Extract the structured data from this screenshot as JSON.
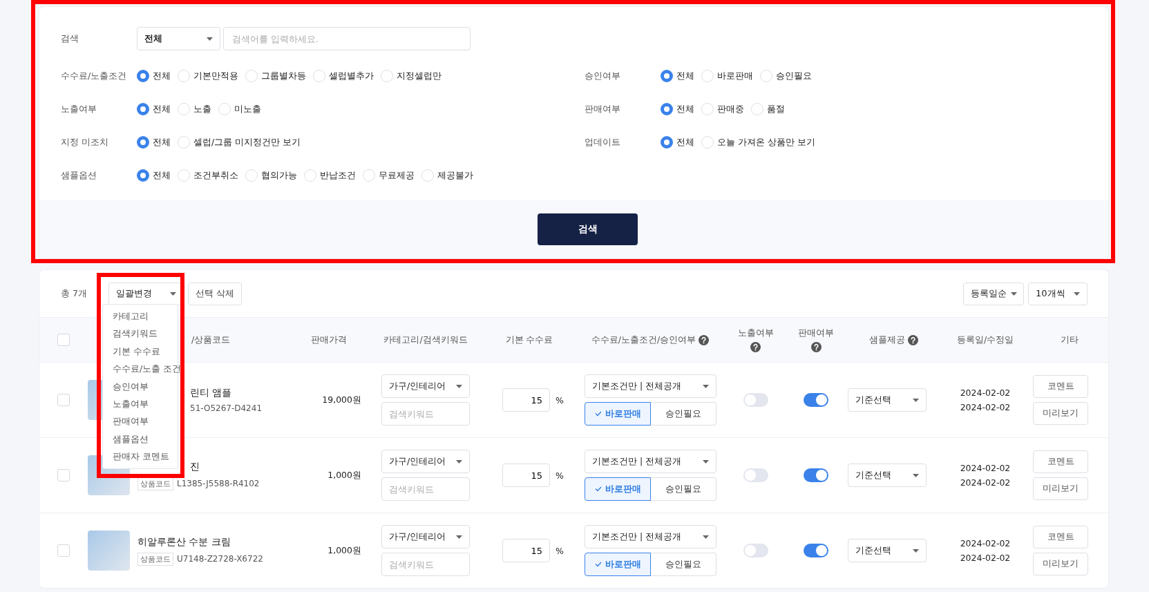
{
  "search_panel": {
    "label": "검색",
    "scope_select": "전체",
    "placeholder": "검색어를 입력하세요.",
    "left_filters": [
      {
        "label": "수수료/노출조건",
        "options": [
          {
            "label": "전체",
            "selected": true
          },
          {
            "label": "기본만적용",
            "selected": false
          },
          {
            "label": "그룹별차등",
            "selected": false
          },
          {
            "label": "셀럽별추가",
            "selected": false
          },
          {
            "label": "지정셀럽만",
            "selected": false
          }
        ]
      },
      {
        "label": "노출여부",
        "options": [
          {
            "label": "전체",
            "selected": true
          },
          {
            "label": "노출",
            "selected": false
          },
          {
            "label": "미노출",
            "selected": false
          }
        ]
      },
      {
        "label": "지정 미조치",
        "options": [
          {
            "label": "전체",
            "selected": true
          },
          {
            "label": "셀럽/그룹 미지정건만 보기",
            "selected": false
          }
        ]
      },
      {
        "label": "샘플옵션",
        "options": [
          {
            "label": "전체",
            "selected": true
          },
          {
            "label": "조건부취소",
            "selected": false
          },
          {
            "label": "협의가능",
            "selected": false
          },
          {
            "label": "반납조건",
            "selected": false
          },
          {
            "label": "무료제공",
            "selected": false
          },
          {
            "label": "제공불가",
            "selected": false
          }
        ]
      }
    ],
    "right_filters": [
      {
        "label": "승인여부",
        "options": [
          {
            "label": "전체",
            "selected": true
          },
          {
            "label": "바로판매",
            "selected": false
          },
          {
            "label": "승인필요",
            "selected": false
          }
        ]
      },
      {
        "label": "판매여부",
        "options": [
          {
            "label": "전체",
            "selected": true
          },
          {
            "label": "판매중",
            "selected": false
          },
          {
            "label": "품절",
            "selected": false
          }
        ]
      },
      {
        "label": "업데이트",
        "options": [
          {
            "label": "전체",
            "selected": true
          },
          {
            "label": "오늘 가져온 상품만 보기",
            "selected": false
          }
        ]
      }
    ],
    "search_button": "검색"
  },
  "toolbar": {
    "total": "총 7개",
    "bulk_select": "일괄변경",
    "delete_button": "선택 삭제",
    "sort_select": "등록일순",
    "page_size_select": "10개씩"
  },
  "bulk_menu": {
    "items": [
      "카테고리",
      "검색키워드",
      "기본 수수료",
      "수수료/노출 조건",
      "승인여부",
      "노출여부",
      "판매여부",
      "샘플옵션",
      "판매자 코멘트"
    ]
  },
  "table": {
    "select_all_checked": false,
    "columns": [
      {
        "label": "/상품코드",
        "help": false
      },
      {
        "label": "판매가격",
        "help": false
      },
      {
        "label": "카테고리/검색키워드",
        "help": false
      },
      {
        "label": "기본 수수료",
        "help": false
      },
      {
        "label": "수수료/노출조건/승인여부",
        "help": true
      },
      {
        "label": "노출여부",
        "help": true
      },
      {
        "label": "판매여부",
        "help": true
      },
      {
        "label": "샘플제공",
        "help": true
      },
      {
        "label": "등록일/수정일",
        "help": false
      },
      {
        "label": "기타",
        "help": false
      }
    ],
    "rows": [
      {
        "checked": false,
        "covered": true,
        "name": "린티 앰플",
        "code": "51-O5267-D4241",
        "price": "19,000원",
        "category": "가구/인테리어",
        "keyword_placeholder": "검색키워드",
        "fee": "15",
        "fee_unit": "%",
        "condition": "기본조건만 | 전체공개",
        "approval": [
          {
            "label": "바로판매",
            "selected": true
          },
          {
            "label": "승인필요",
            "selected": false
          }
        ],
        "exposed": false,
        "on_sale": true,
        "sample": "기준선택",
        "created": "2024-02-02",
        "updated": "2024-02-02",
        "buttons": [
          "코멘트",
          "미리보기"
        ]
      },
      {
        "checked": false,
        "covered": true,
        "name": "진",
        "code_tag": "상품코드",
        "code": "L1385-J5588-R4102",
        "price": "1,000원",
        "category": "가구/인테리어",
        "keyword_placeholder": "검색키워드",
        "fee": "15",
        "fee_unit": "%",
        "condition": "기본조건만 | 전체공개",
        "approval": [
          {
            "label": "바로판매",
            "selected": true
          },
          {
            "label": "승인필요",
            "selected": false
          }
        ],
        "exposed": false,
        "on_sale": true,
        "sample": "기준선택",
        "created": "2024-02-02",
        "updated": "2024-02-02",
        "buttons": [
          "코멘트",
          "미리보기"
        ]
      },
      {
        "checked": false,
        "covered": false,
        "name": "히알루론산 수분 크림",
        "code_tag": "상품코드",
        "code": "U7148-Z2728-X6722",
        "price": "1,000원",
        "category": "가구/인테리어",
        "keyword_placeholder": "검색키워드",
        "fee": "15",
        "fee_unit": "%",
        "condition": "기본조건만 | 전체공개",
        "approval": [
          {
            "label": "바로판매",
            "selected": true
          },
          {
            "label": "승인필요",
            "selected": false
          }
        ],
        "exposed": false,
        "on_sale": true,
        "sample": "기준선택",
        "created": "2024-02-02",
        "updated": "2024-02-02",
        "buttons": [
          "코멘트",
          "미리보기"
        ]
      }
    ]
  }
}
